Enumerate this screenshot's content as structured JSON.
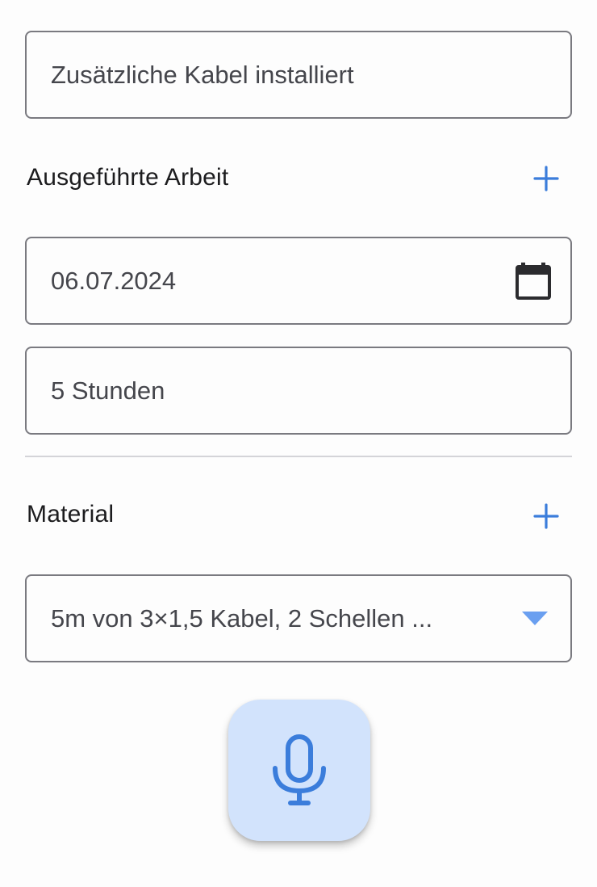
{
  "description_field": {
    "value": "Zusätzliche Kabel installiert"
  },
  "work_section": {
    "title": "Ausgeführte Arbeit",
    "add_icon": "plus-icon",
    "date_field": {
      "value": "06.07.2024",
      "icon": "calendar-icon"
    },
    "hours_field": {
      "value": "5 Stunden"
    }
  },
  "material_section": {
    "title": "Material",
    "add_icon": "plus-icon",
    "material_select": {
      "value": "5m von 3×1,5 Kabel, 2 Schellen ...",
      "icon": "dropdown-arrow-icon"
    }
  },
  "mic_button": {
    "icon": "microphone-icon"
  },
  "colors": {
    "accent": "#3b7ddb",
    "mic_background": "#d2e3fc",
    "dropdown_arrow": "#6a9ff0",
    "field_border": "#7a7a80",
    "divider": "#d4d4d8"
  }
}
